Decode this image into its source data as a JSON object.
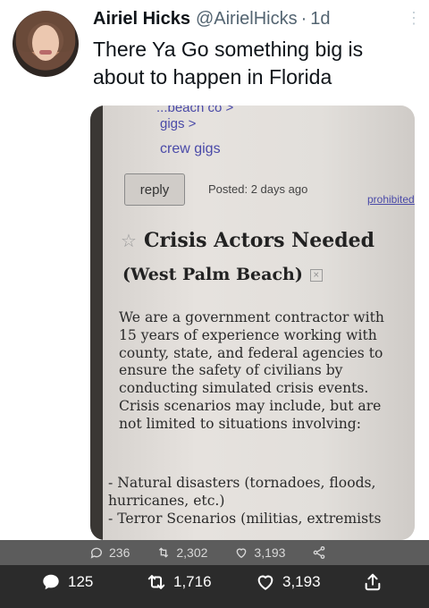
{
  "author": {
    "name": "Airiel Hicks",
    "handle": "@AirielHicks",
    "separator": "·",
    "time": "1d"
  },
  "tweet": {
    "text": "There Ya Go something big is about to happen in Florida"
  },
  "photo": {
    "link_top": "...beach co >",
    "link_gigs": "gigs >",
    "link_crew": "crew gigs",
    "reply_label": "reply",
    "posted_label": "Posted:",
    "posted_value": "2 days ago",
    "prohibited_label": "prohibited",
    "title": "Crisis Actors Needed",
    "location": "(West Palm Beach)",
    "body_lines": [
      "We are a government contractor with",
      "15 years of experience working with",
      "county, state, and federal agencies to",
      "ensure the safety of civilians by",
      "conducting simulated crisis events.",
      "Crisis scenarios may include, but are",
      "not limited to situations involving:"
    ],
    "list_lines": [
      "- Natural disasters (tornadoes, floods,",
      "hurricanes, etc.)",
      "- Terror Scenarios (militias, extremists"
    ]
  },
  "faded_stats": {
    "replies": "236",
    "retweets": "2,302",
    "likes": "3,193"
  },
  "actions": {
    "replies": "125",
    "retweets": "1,716",
    "likes": "3,193"
  },
  "colors": {
    "text": "#0f1419",
    "secondary": "#536471",
    "link_blue": "#4a4aa8",
    "action_bar": "#2b2b2b"
  }
}
